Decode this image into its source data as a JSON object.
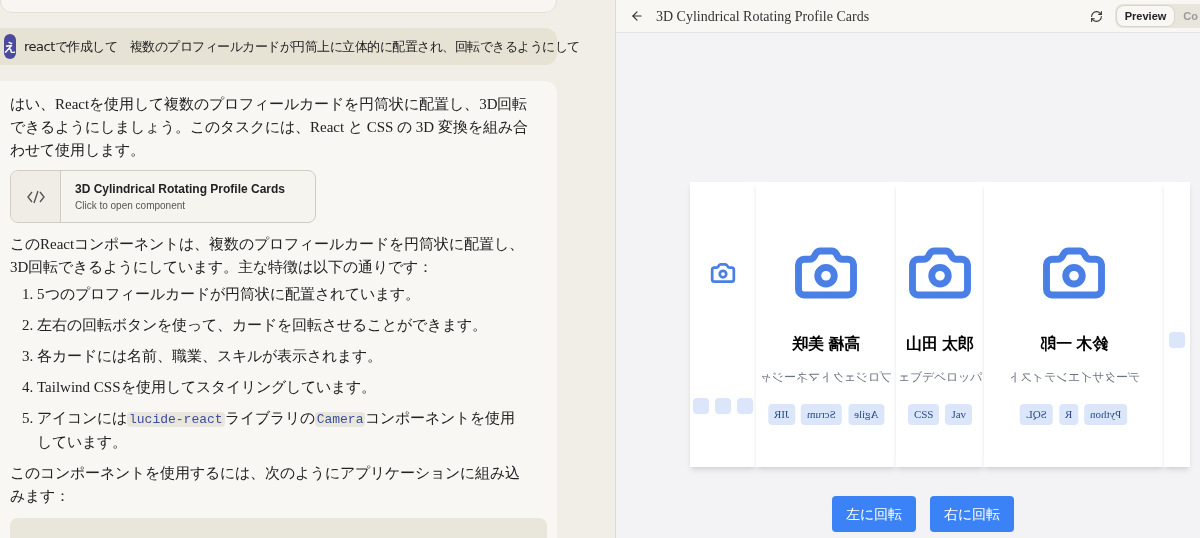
{
  "chat": {
    "user_message": {
      "avatar": "え",
      "text": "reactで作成して　複数のプロフィールカードが円筒上に立体的に配置され、回転できるようにして"
    },
    "response": {
      "intro": "はい、Reactを使用して複数のプロフィールカードを円筒状に配置し、3D回転できるようにしましょう。このタスクには、React と CSS の 3D 変換を組み合わせて使用します。",
      "artifact": {
        "title": "3D Cylindrical Rotating Profile Cards",
        "subtitle": "Click to open component"
      },
      "paragraph": "このReactコンポーネントは、複数のプロフィールカードを円筒状に配置し、3D回転できるようにしています。主な特徴は以下の通りです：",
      "list": [
        {
          "number": "1.",
          "segments": [
            {
              "kind": "text",
              "text": "5つのプロフィールカードが円筒状に配置されています。"
            }
          ]
        },
        {
          "number": "2.",
          "segments": [
            {
              "kind": "text",
              "text": "左右の回転ボタンを使って、カードを回転させることができます。"
            }
          ]
        },
        {
          "number": "3.",
          "segments": [
            {
              "kind": "text",
              "text": "各カードには名前、職業、スキルが表示されます。"
            }
          ]
        },
        {
          "number": "4.",
          "segments": [
            {
              "kind": "text",
              "text": "Tailwind CSSを使用してスタイリングしています。"
            }
          ]
        },
        {
          "number": "5.",
          "segments": [
            {
              "kind": "text",
              "text": "アイコンには"
            },
            {
              "kind": "code",
              "text": "lucide-react"
            },
            {
              "kind": "text",
              "text": "ライブラリの"
            },
            {
              "kind": "code",
              "text": "Camera"
            },
            {
              "kind": "text",
              "text": "コンポーネントを使用しています。"
            }
          ]
        }
      ],
      "outro": "このコンポーネントを使用するには、次のようにアプリケーションに組み込みます："
    }
  },
  "preview": {
    "title": "3D Cylindrical Rotating Profile Cards",
    "tabs": [
      {
        "label": "Preview",
        "selected": true
      },
      {
        "label": "Co",
        "selected": false
      }
    ],
    "cards": [
      {
        "kind": "sliver"
      },
      {
        "mirrored": true,
        "kind": "medium",
        "name": "高橋 美咲",
        "role": "プロジェクトマネージャ",
        "skills": [
          "JIR",
          "Scrum",
          "Agile"
        ]
      },
      {
        "mirrored": false,
        "kind": "narrow",
        "name": "山田 太郎",
        "role": "ェブデベロッパ",
        "skills": [
          "CSS",
          "Jav"
        ]
      },
      {
        "mirrored": true,
        "kind": "wide",
        "name": "鈴木 一郎",
        "role": "データサイエンティスト",
        "skills": [
          "SQL",
          "R",
          "Python"
        ]
      },
      {
        "kind": "edge"
      }
    ],
    "buttons": [
      "左に回転",
      "右に回転"
    ]
  }
}
